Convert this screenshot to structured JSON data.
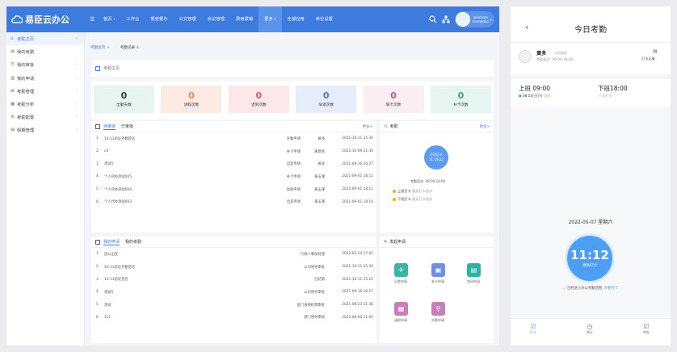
{
  "topbar": {
    "brand": "易臣云办公",
    "menu_icon": "☰",
    "nav": [
      "首页 ›",
      "工作台",
      "督查督办",
      "公文管理",
      "会议管理",
      "费用报销",
      "更多 ›",
      "全部应用",
      "单位设置"
    ],
    "active_nav": 6,
    "welcome": "welcome",
    "user": "huangduo"
  },
  "sidebar": {
    "items": [
      {
        "icon": "⌂",
        "label": "考勤主页",
        "arrow": "‹"
      },
      {
        "icon": "▤",
        "label": "我的考勤",
        "arrow": ""
      },
      {
        "icon": "☰",
        "label": "我的审批",
        "arrow": "›"
      },
      {
        "icon": "▥",
        "label": "我的申请",
        "arrow": "›"
      },
      {
        "icon": "⊞",
        "label": "考勤管理",
        "arrow": "›"
      },
      {
        "icon": "▦",
        "label": "考勤分析",
        "arrow": "›"
      },
      {
        "icon": "⚙",
        "label": "考勤配置",
        "arrow": "›"
      },
      {
        "icon": "▤",
        "label": "假期管理",
        "arrow": "›"
      }
    ]
  },
  "tabs": [
    "考勤主页 ×",
    "考勤记录 ×"
  ],
  "breadcrumb": "考勤主页",
  "stats": [
    {
      "value": "0",
      "label": "出勤天数",
      "bg": "#e6f5ef",
      "color": "#3a3a3a"
    },
    {
      "value": "0",
      "label": "请假次数",
      "bg": "#fdebe3",
      "color": "#e58a5b"
    },
    {
      "value": "0",
      "label": "迟到次数",
      "bg": "#fde7ea",
      "color": "#e05b6b"
    },
    {
      "value": "0",
      "label": "早退次数",
      "bg": "#e5edfb",
      "color": "#4b7bdf"
    },
    {
      "value": "0",
      "label": "缺卡次数",
      "bg": "#fbeef3",
      "color": "#c4588a"
    },
    {
      "value": "0",
      "label": "补卡次数",
      "bg": "#e6f5ef",
      "color": "#3aa776"
    }
  ],
  "approvals": {
    "tab1": "待审批",
    "tab2": "已审批",
    "more": "更多>",
    "rows": [
      {
        "n": "1",
        "title": "10-11验证外勤签名",
        "type": "外勤申请",
        "person": "黄多",
        "time": "2021-10-11 15:30"
      },
      {
        "n": "2",
        "title": "cd",
        "type": "补卡申请",
        "person": "黄恩瑶",
        "time": "2021-10-09 21:35"
      },
      {
        "n": "3",
        "title": "测试5",
        "type": "出差申请",
        "person": "黄多",
        "time": "2021-09-16 16:27"
      },
      {
        "n": "4",
        "title": "个人待办测试005",
        "type": "补卡申请",
        "person": "黄玉瑾",
        "time": "2021-09-01 18:11"
      },
      {
        "n": "5",
        "title": "个人待办测试004",
        "type": "加班申请",
        "person": "黄玉瑾",
        "time": "2021-09-01 18:11"
      },
      {
        "n": "6",
        "title": "个人代办测试003",
        "type": "出差申请",
        "person": "黄玉瑾",
        "time": "2021-09-01 18:10"
      }
    ]
  },
  "attendance": {
    "title": "考勤",
    "more": "更多>",
    "status": "不可打卡",
    "time": "11:19:22",
    "shift_label": "考勤班次:",
    "shift": "09:00-18:00",
    "on_label": "上班打卡",
    "on_note": "暂无打卡班次",
    "off_label": "下班打卡",
    "off_note": "暂无打卡班次"
  },
  "applications": {
    "tab1": "我的申请",
    "tab2": "我的考勤",
    "rows": [
      {
        "n": "1",
        "title": "因公出差",
        "status": "行政人事部处理",
        "time": "2022-02-24 17:01"
      },
      {
        "n": "2",
        "title": "10-11验证外勤签名",
        "status": "公司领导审批",
        "time": "2021-10-11 15:30"
      },
      {
        "n": "3",
        "title": "10-11验证签名",
        "status": "已结束",
        "time": "2021-10-11 15:25"
      },
      {
        "n": "4",
        "title": "测试5",
        "status": "公司领导审批",
        "time": "2021-09-16 16:27"
      },
      {
        "n": "5",
        "title": "测试",
        "status": "部门直线经理审批",
        "time": "2021-08-23 11:36"
      },
      {
        "n": "6",
        "title": "111",
        "status": "部门领导审核",
        "time": "2021-08-04 11:05"
      }
    ]
  },
  "launch": {
    "title": "发起申请",
    "apps": [
      {
        "label": "出差申请",
        "color": "#3bb6a3",
        "glyph": "✈"
      },
      {
        "label": "补卡申请",
        "color": "#6f8fe8",
        "glyph": "▣"
      },
      {
        "label": "加班申请",
        "color": "#2bb3a8",
        "glyph": "▤"
      },
      {
        "label": "请假申请",
        "color": "#c87fb8",
        "glyph": "▦"
      },
      {
        "label": "外勤申请",
        "color": "#c87fb8",
        "glyph": "⚲"
      }
    ]
  },
  "phone": {
    "title": "今日考勤",
    "back": "‹",
    "user": "黄多",
    "role": "公司领导",
    "shift": "考勤班次: 09:00-18:00",
    "record": "打卡记录",
    "on_time": "上班 09:00",
    "on_status": "08:54已打卡",
    "on_tag": "加班",
    "off_time": "下班18:00",
    "off_status": "未打卡",
    "date": "2022-05-07 星期六",
    "clock": "11:12",
    "clock_sub": "更新打卡",
    "location": "已经进入办公考勤范围",
    "outside": "外勤打卡",
    "bottom": [
      "打卡",
      "统计",
      "审批"
    ]
  }
}
